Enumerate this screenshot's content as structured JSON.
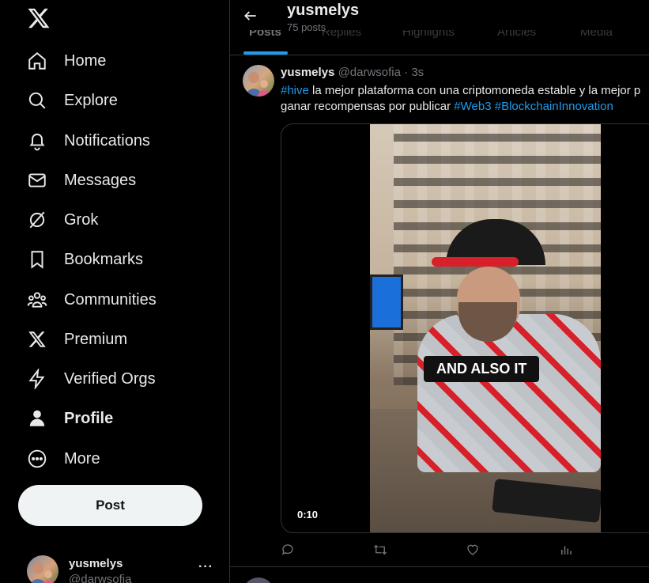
{
  "nav": {
    "logo": "x-logo-icon",
    "items": [
      {
        "label": "Home",
        "icon": "home-icon"
      },
      {
        "label": "Explore",
        "icon": "search-icon"
      },
      {
        "label": "Notifications",
        "icon": "bell-icon"
      },
      {
        "label": "Messages",
        "icon": "envelope-icon"
      },
      {
        "label": "Grok",
        "icon": "grok-icon"
      },
      {
        "label": "Bookmarks",
        "icon": "bookmark-icon"
      },
      {
        "label": "Communities",
        "icon": "people-icon"
      },
      {
        "label": "Premium",
        "icon": "x-logo-icon"
      },
      {
        "label": "Verified Orgs",
        "icon": "lightning-icon"
      },
      {
        "label": "Profile",
        "icon": "person-icon"
      },
      {
        "label": "More",
        "icon": "more-circle-icon"
      }
    ],
    "post_label": "Post"
  },
  "account": {
    "name": "yusmelys",
    "handle": "@darwsofia",
    "more": "···"
  },
  "profile_header": {
    "title": "yusmelys",
    "post_count": "75 posts",
    "tabs": [
      "Posts",
      "Replies",
      "Highlights",
      "Articles",
      "Media"
    ]
  },
  "tweet": {
    "name": "yusmelys",
    "handle": "@darwsofia · 3s",
    "line1_hashtag": "#hive",
    "line1_text": " la mejor plataforma con una criptomoneda estable y la mejor p",
    "line2_text": "ganar recompensas por publicar ",
    "line2_hashtag1": "#Web3",
    "line2_hashtag2": "#BlockchainInnovation",
    "video_caption": "AND ALSO IT",
    "video_duration": "0:10"
  },
  "colors": {
    "background": "#000000",
    "accent": "#1d9bf0",
    "text": "#e7e9ea",
    "muted": "#71767b",
    "border": "#2f3336"
  }
}
